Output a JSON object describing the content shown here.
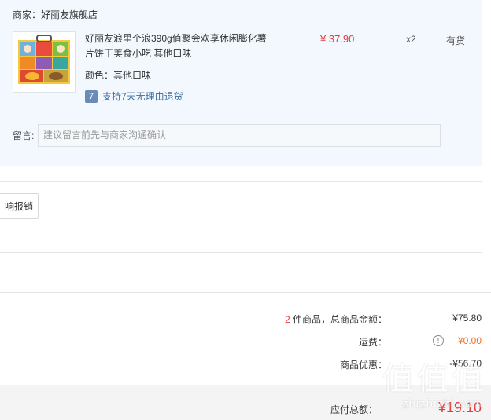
{
  "order": {
    "shop_line": "商家：好丽友旗舰店",
    "product_title": "好丽友浪里个浪390g值聚会欢享休闲膨化薯片饼干美食小吃 其他口味",
    "spec": "颜色：其他口味",
    "return_badge": "7",
    "return_policy": "支持7天无理由退货",
    "price": "¥ 37.90",
    "quantity": "x2",
    "stock_status": "有货",
    "note_label": "留言:",
    "note_placeholder": "建议留言前先与商家沟通确认"
  },
  "invoice": {
    "button_label": "响报销"
  },
  "summary": {
    "item_count": "2",
    "goods_total_label": "件商品，总商品金额：",
    "goods_total_value": "¥75.80",
    "shipping_label": "运费：",
    "shipping_value": "¥0.00",
    "discount_label": "商品优惠：",
    "discount_value": "-¥56.70",
    "payable_label": "应付总额：",
    "payable_value": "¥19.10"
  },
  "watermark": {
    "text": "值值值",
    "sub": "zhizhizhi.com"
  },
  "colors": {
    "accent_red": "#e4393c",
    "orange": "#f26d21",
    "panel_bg": "#f2f8fe"
  }
}
